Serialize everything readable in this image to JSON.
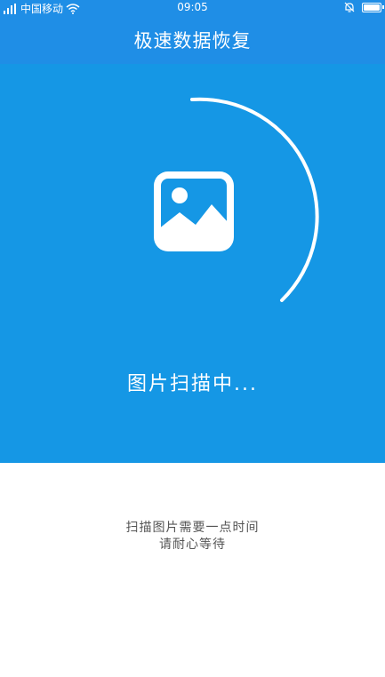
{
  "status_bar": {
    "carrier": "中国移动",
    "time": "09:05",
    "icons": [
      "signal-icon",
      "wifi-icon",
      "alarm-icon",
      "battery-icon"
    ]
  },
  "header": {
    "title": "极速数据恢复"
  },
  "scan": {
    "status_text": "图片扫描中...",
    "icon": "picture-icon"
  },
  "hint": {
    "line1": "扫描图片需要一点时间",
    "line2": "请耐心等待"
  },
  "colors": {
    "header_blue": "#1f8ee6",
    "panel_blue": "#1597e5",
    "hint_text": "#555555"
  }
}
